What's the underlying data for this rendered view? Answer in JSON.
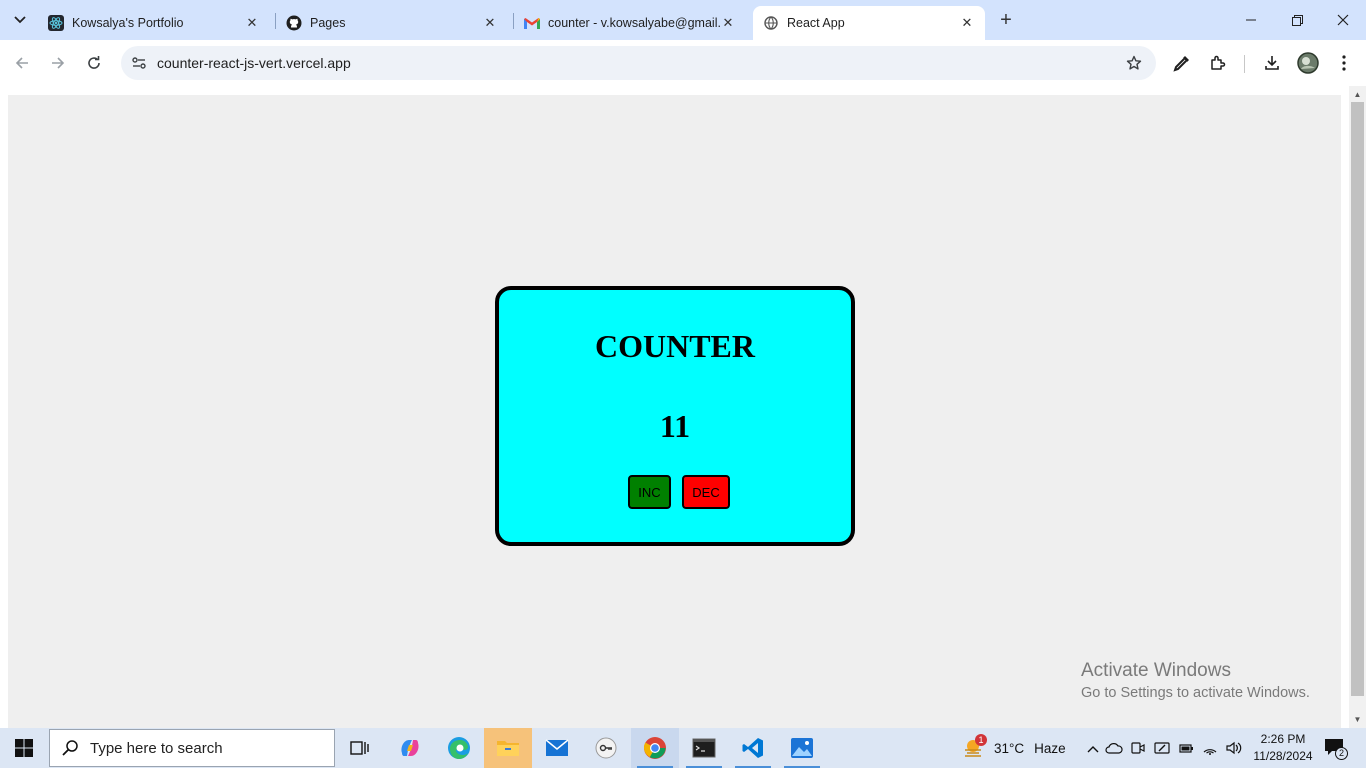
{
  "browser": {
    "tabs": [
      {
        "title": "Kowsalya's Portfolio",
        "icon": "react-icon",
        "active": false
      },
      {
        "title": "Pages",
        "icon": "github-icon",
        "active": false
      },
      {
        "title": "counter - v.kowsalyabe@gmail.com",
        "icon": "gmail-icon",
        "active": false
      },
      {
        "title": "React App",
        "icon": "globe-icon",
        "active": true
      }
    ],
    "url": "counter-react-js-vert.vercel.app"
  },
  "app": {
    "title": "COUNTER",
    "count": "11",
    "inc_label": "INC",
    "dec_label": "DEC",
    "colors": {
      "card": "#00ffff",
      "inc": "#008000",
      "dec": "#ff0000"
    }
  },
  "watermark": {
    "line1": "Activate Windows",
    "line2": "Go to Settings to activate Windows."
  },
  "taskbar": {
    "search_placeholder": "Type here to search",
    "weather_temp": "31°C",
    "weather_desc": "Haze",
    "weather_badge": "1",
    "time": "2:26 PM",
    "date": "11/28/2024",
    "notification_count": "2"
  }
}
